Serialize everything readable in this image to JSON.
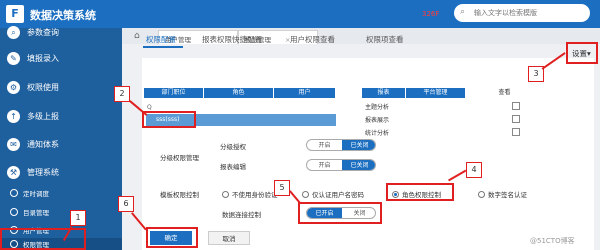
{
  "app": {
    "title": "数据决策系统",
    "logo_letter": "F",
    "username": "326F",
    "search_placeholder": "输入文字以检索模版"
  },
  "sidebar": {
    "items": [
      {
        "label": "参数查询",
        "icon": "query-icon"
      },
      {
        "label": "填报录入",
        "icon": "edit-icon"
      },
      {
        "label": "权限使用",
        "icon": "permission-icon"
      },
      {
        "label": "多级上报",
        "icon": "report-icon"
      },
      {
        "label": "通知体系",
        "icon": "notify-icon"
      },
      {
        "label": "管理系统",
        "icon": "admin-icon"
      }
    ],
    "subitems": [
      {
        "label": "定时调度"
      },
      {
        "label": "目录管理"
      },
      {
        "label": "用户管理"
      },
      {
        "label": "权限管理"
      }
    ]
  },
  "tabs": [
    {
      "label": "用户管理"
    },
    {
      "label": "权限管理"
    }
  ],
  "subtabs": [
    "权限配置",
    "报表权限快捷配置",
    "用户权限查看",
    "权限项查看"
  ],
  "settings_label": "设置▾",
  "left_table": {
    "headers": [
      "部门职位",
      "角色",
      "用户"
    ],
    "search_icon": "Q",
    "selected_row": "sss(sss)"
  },
  "right_table": {
    "headers": [
      "报表",
      "平台管理",
      "查看"
    ],
    "rows": [
      "主题分析",
      "报表展示",
      "统计分析"
    ]
  },
  "form": {
    "section_label": "分级权限管理",
    "grade_auth_label": "分级授权",
    "report_edit_label": "报表编辑",
    "toggle_on": "开启",
    "toggle_off": "已关闭",
    "template_control_label": "模板权限控制",
    "template_options": [
      "不使用身份验证",
      "仅认证用户名密码",
      "角色权限控制",
      "数字签名认证"
    ],
    "data_conn_label": "数据连接控制",
    "data_conn_on": "已开启",
    "data_conn_off": "关闭"
  },
  "buttons": {
    "confirm": "确定",
    "cancel": "取消"
  },
  "callouts": [
    "1",
    "2",
    "3",
    "4",
    "5",
    "6"
  ],
  "watermark": "@51CTO博客"
}
